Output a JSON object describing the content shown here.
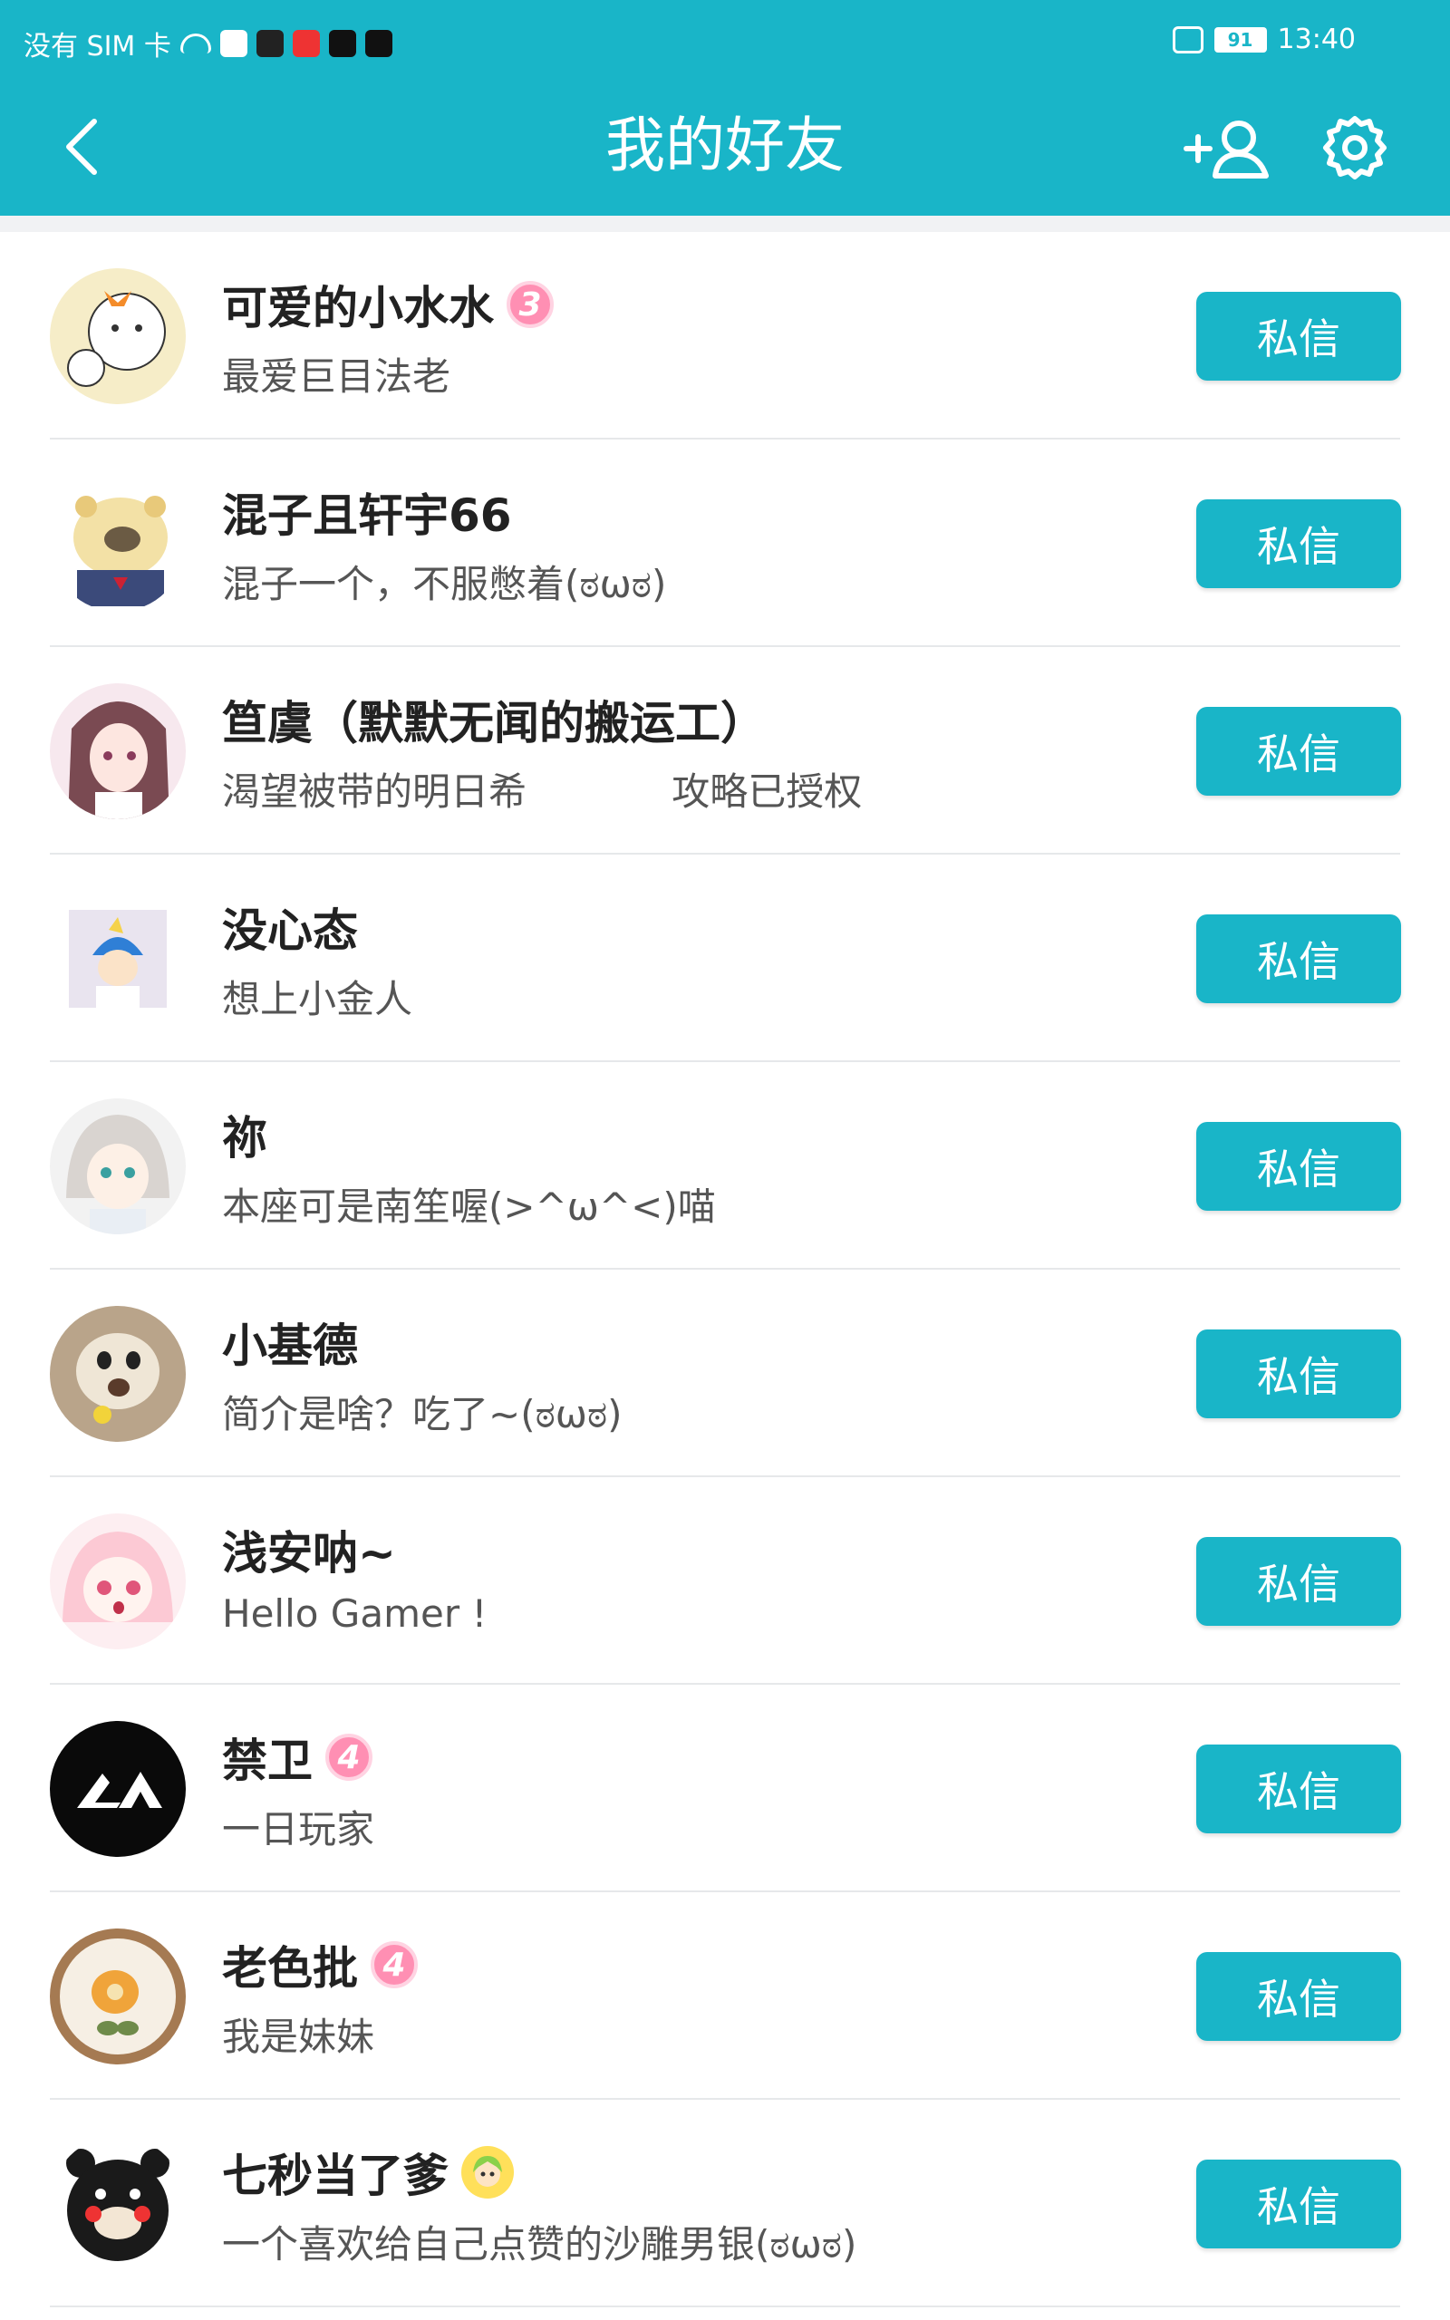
{
  "status_bar": {
    "carrier": "没有 SIM 卡",
    "battery": "91",
    "time": "13:40"
  },
  "header": {
    "title": "我的好友",
    "back_icon": "chevron-left-icon",
    "add_friend_icon": "add-user-icon",
    "settings_icon": "gear-icon"
  },
  "colors": {
    "accent": "#19b5c8",
    "badge_pink": "#ff8fb3"
  },
  "friends": [
    {
      "name": "可爱的小水水",
      "bio": "最爱巨目法老",
      "level": "3",
      "button": "私信"
    },
    {
      "name": "混子且轩宇66",
      "bio": "混子一个，不服憋着(ಠωಠ)",
      "level": "",
      "button": "私信"
    },
    {
      "name": "笪虞（默默无闻的搬运工）",
      "bio": "渴望被带的明日希            攻略已授权",
      "level": "",
      "button": "私信"
    },
    {
      "name": "没心态",
      "bio": "想上小金人",
      "level": "",
      "button": "私信"
    },
    {
      "name": "祢",
      "bio": "本座可是南笙喔(>^ω^<)喵",
      "level": "",
      "button": "私信"
    },
    {
      "name": "小基德",
      "bio": "简介是啥？吃了~(ಠωಠ)",
      "level": "",
      "button": "私信"
    },
    {
      "name": "浅安呐~",
      "bio": "Hello Gamer !",
      "level": "",
      "button": "私信"
    },
    {
      "name": "禁卫",
      "bio": "一日玩家",
      "level": "4",
      "button": "私信"
    },
    {
      "name": "老色批",
      "bio": "我是妹妹",
      "level": "4",
      "button": "私信"
    },
    {
      "name": "七秒当了爹",
      "bio": "一个喜欢给自己点赞的沙雕男银(ಠωಠ)",
      "level": "",
      "button": "私信"
    }
  ]
}
